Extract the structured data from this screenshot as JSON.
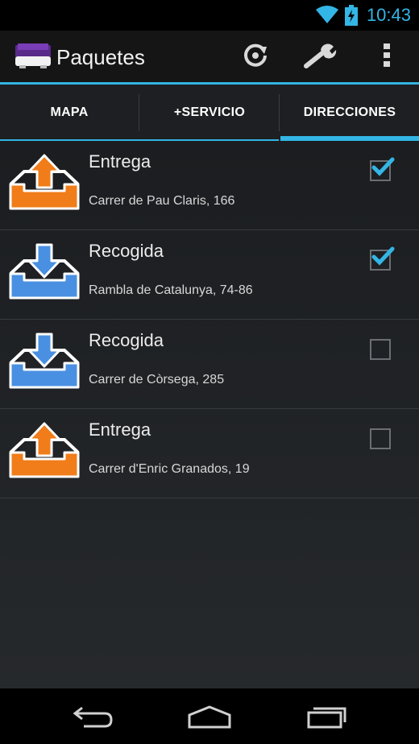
{
  "status_bar": {
    "time": "10:43",
    "wifi_icon": "wifi-icon",
    "battery_icon": "battery-charging-icon"
  },
  "action_bar": {
    "title": "Paquetes",
    "app_icon": "truck-icon",
    "actions": [
      "refresh-icon",
      "wrench-icon",
      "overflow-menu-icon"
    ]
  },
  "tabs": [
    {
      "label": "MAPA",
      "selected": false
    },
    {
      "label": "+SERVICIO",
      "selected": false
    },
    {
      "label": "DIRECCIONES",
      "selected": true
    }
  ],
  "items": [
    {
      "type": "Entrega",
      "address": "Carrer de Pau Claris, 166",
      "icon": "delivery-upload-icon",
      "checked": true
    },
    {
      "type": "Recogida",
      "address": "Rambla de Catalunya, 74-86",
      "icon": "pickup-download-icon",
      "checked": true
    },
    {
      "type": "Recogida",
      "address": "Carrer de Còrsega, 285",
      "icon": "pickup-download-icon",
      "checked": false
    },
    {
      "type": "Entrega",
      "address": "Carrer d'Enric Granados, 19",
      "icon": "delivery-upload-icon",
      "checked": false
    }
  ],
  "nav_bar": {
    "icons": [
      "back-icon",
      "home-icon",
      "recent-apps-icon"
    ]
  },
  "colors": {
    "accent": "#33b5e5",
    "delivery": "#f07d1a",
    "pickup": "#4a90e2"
  }
}
